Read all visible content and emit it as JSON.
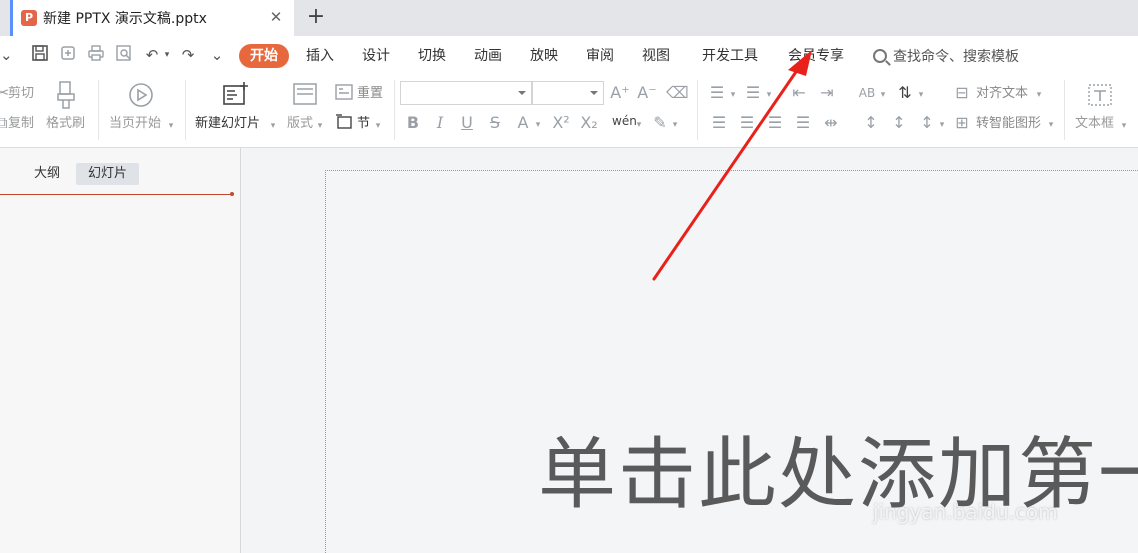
{
  "tabbar": {
    "doc_title": "新建 PPTX 演示文稿.pptx",
    "close_glyph": "✕",
    "add_glyph": "+"
  },
  "menu": {
    "active": "开始",
    "items": [
      "插入",
      "设计",
      "切换",
      "动画",
      "放映",
      "审阅",
      "视图",
      "开发工具",
      "会员专享"
    ],
    "search_label": "查找命令、搜索模板"
  },
  "ribbon": {
    "cut": "剪切",
    "copy": "复制",
    "format_painter": "格式刷",
    "from_current": "当页开始",
    "new_slide": "新建幻灯片",
    "layout": "版式",
    "reset": "重置",
    "section": "节",
    "align_text": "对齐文本",
    "convert_smartart": "转智能图形",
    "textbox": "文本框"
  },
  "sidebar": {
    "tab_outline": "大纲",
    "tab_slides": "幻灯片"
  },
  "slide": {
    "title_placeholder": "单击此处添加第一"
  },
  "watermark": "jingyan.baidu.com",
  "colors": {
    "accent": "#e8683d",
    "arrow": "#e8221b",
    "tab_indicator": "#5b8ff9"
  }
}
